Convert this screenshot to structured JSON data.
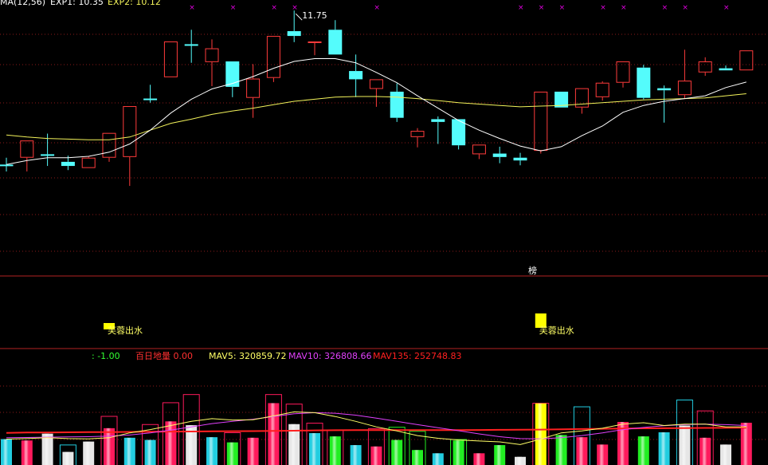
{
  "colors": {
    "up": "#ff3b3b",
    "down": "#54fcfc",
    "ma1": "#ffffff",
    "ma2": "#f2f25a",
    "panel_border": "#b22222",
    "grid": "#8b1a1a",
    "signal_box": "#ffff00",
    "signal_text": "#ffff66",
    "marker": "#e000e0",
    "mav5": "#ffff66",
    "mav10": "#e040fb",
    "mav135": "#ff2020",
    "value_green": "#33ff33",
    "white": "#ffffff",
    "vol_red": "#ff1a5c",
    "vol_cyan": "#22cde0",
    "vol_green": "#22ee22",
    "vol_white": "#e6e6e6",
    "vol_yellow": "#ffff00"
  },
  "price_panel": {
    "legend": [
      {
        "text": "MA(12,56)",
        "color": "#ffffff"
      },
      {
        "text": "EXP1: 10.35",
        "color": "#ffffff"
      },
      {
        "text": "EXP2: 10.12",
        "color": "#f2f25a"
      }
    ],
    "high_annotation": "11.75"
  },
  "signal_panel": {
    "bang_label": "榜",
    "signals": [
      {
        "candle": 5,
        "label": "芙蓉出水",
        "size": "small"
      },
      {
        "candle": 26,
        "label": "芙蓉出水",
        "size": "large"
      }
    ]
  },
  "volume_panel": {
    "indicators": [
      {
        "text": ": -1.00",
        "color": "#33ff33"
      },
      {
        "text": "百日地量  0.00",
        "color": "#ff3030"
      },
      {
        "text": "MAV5: 320859.72",
        "color": "#ffff66"
      },
      {
        "text": "MAV10: 326808.66",
        "color": "#e040fb"
      },
      {
        "text": "MAV135: 252748.83",
        "color": "#ff2020"
      }
    ]
  },
  "chart_data": {
    "type": "candlestick",
    "ylim": [
      8.25,
      12.1
    ],
    "candles": [
      {
        "o": 9.8,
        "h": 9.9,
        "l": 9.7,
        "c": 9.8,
        "dir": "down"
      },
      {
        "o": 9.9,
        "h": 10.15,
        "l": 9.7,
        "c": 10.15,
        "dir": "up"
      },
      {
        "o": 9.95,
        "h": 10.25,
        "l": 9.78,
        "c": 9.95,
        "dir": "down"
      },
      {
        "o": 9.78,
        "h": 9.93,
        "l": 9.72,
        "c": 9.84,
        "dir": "down"
      },
      {
        "o": 9.75,
        "h": 9.92,
        "l": 9.75,
        "c": 9.9,
        "dir": "up"
      },
      {
        "o": 9.9,
        "h": 10.26,
        "l": 9.84,
        "c": 10.26,
        "dir": "up"
      },
      {
        "o": 9.91,
        "h": 10.65,
        "l": 9.49,
        "c": 10.65,
        "dir": "up"
      },
      {
        "o": 10.76,
        "h": 10.96,
        "l": 10.7,
        "c": 10.76,
        "dir": "down"
      },
      {
        "o": 11.07,
        "h": 11.59,
        "l": 11.07,
        "c": 11.59,
        "dir": "up"
      },
      {
        "o": 11.55,
        "h": 11.76,
        "l": 11.28,
        "c": 11.55,
        "dir": "down"
      },
      {
        "o": 11.29,
        "h": 11.62,
        "l": 10.94,
        "c": 11.49,
        "dir": "up"
      },
      {
        "o": 11.3,
        "h": 11.3,
        "l": 10.78,
        "c": 10.93,
        "dir": "down"
      },
      {
        "o": 10.77,
        "h": 11.26,
        "l": 10.48,
        "c": 11.05,
        "dir": "up"
      },
      {
        "o": 11.06,
        "h": 11.67,
        "l": 11.0,
        "c": 11.67,
        "dir": "up"
      },
      {
        "o": 11.74,
        "h": 12.04,
        "l": 11.58,
        "c": 11.67,
        "dir": "down"
      },
      {
        "o": 11.59,
        "h": 11.59,
        "l": 11.39,
        "c": 11.59,
        "dir": "up"
      },
      {
        "o": 11.76,
        "h": 11.9,
        "l": 11.4,
        "c": 11.4,
        "dir": "down"
      },
      {
        "o": 11.16,
        "h": 11.4,
        "l": 10.78,
        "c": 11.04,
        "dir": "down"
      },
      {
        "o": 10.9,
        "h": 11.04,
        "l": 10.64,
        "c": 11.04,
        "dir": "up"
      },
      {
        "o": 10.86,
        "h": 10.98,
        "l": 10.42,
        "c": 10.48,
        "dir": "down"
      },
      {
        "o": 10.2,
        "h": 10.33,
        "l": 10.05,
        "c": 10.29,
        "dir": "up"
      },
      {
        "o": 10.46,
        "h": 10.5,
        "l": 10.1,
        "c": 10.42,
        "dir": "down"
      },
      {
        "o": 10.46,
        "h": 10.46,
        "l": 10.02,
        "c": 10.08,
        "dir": "down"
      },
      {
        "o": 9.95,
        "h": 10.09,
        "l": 9.88,
        "c": 10.09,
        "dir": "up"
      },
      {
        "o": 9.96,
        "h": 10.06,
        "l": 9.82,
        "c": 9.91,
        "dir": "down"
      },
      {
        "o": 9.9,
        "h": 9.97,
        "l": 9.79,
        "c": 9.86,
        "dir": "down"
      },
      {
        "o": 10.0,
        "h": 10.86,
        "l": 9.96,
        "c": 10.86,
        "dir": "up"
      },
      {
        "o": 10.86,
        "h": 10.86,
        "l": 10.63,
        "c": 10.63,
        "dir": "down"
      },
      {
        "o": 10.63,
        "h": 10.91,
        "l": 10.54,
        "c": 10.91,
        "dir": "up"
      },
      {
        "o": 10.78,
        "h": 11.01,
        "l": 10.73,
        "c": 10.99,
        "dir": "up"
      },
      {
        "o": 10.99,
        "h": 11.3,
        "l": 10.92,
        "c": 11.3,
        "dir": "up"
      },
      {
        "o": 11.21,
        "h": 11.25,
        "l": 10.75,
        "c": 10.77,
        "dir": "down"
      },
      {
        "o": 10.91,
        "h": 10.95,
        "l": 10.41,
        "c": 10.88,
        "dir": "down"
      },
      {
        "o": 10.81,
        "h": 11.47,
        "l": 10.76,
        "c": 11.02,
        "dir": "up"
      },
      {
        "o": 11.14,
        "h": 11.36,
        "l": 11.09,
        "c": 11.3,
        "dir": "up"
      },
      {
        "o": 11.2,
        "h": 11.24,
        "l": 11.17,
        "c": 11.17,
        "dir": "down"
      },
      {
        "o": 11.17,
        "h": 11.46,
        "l": 11.17,
        "c": 11.46,
        "dir": "up"
      }
    ],
    "ma_short": [
      9.8,
      9.86,
      9.9,
      9.9,
      9.92,
      9.98,
      10.1,
      10.3,
      10.55,
      10.75,
      10.9,
      10.98,
      11.08,
      11.2,
      11.3,
      11.34,
      11.34,
      11.28,
      11.14,
      10.99,
      10.8,
      10.62,
      10.44,
      10.3,
      10.18,
      10.07,
      10.0,
      10.06,
      10.22,
      10.36,
      10.56,
      10.66,
      10.72,
      10.76,
      10.8,
      10.92,
      11.0
    ],
    "ma_long": [
      10.23,
      10.2,
      10.18,
      10.17,
      10.16,
      10.16,
      10.2,
      10.3,
      10.4,
      10.46,
      10.53,
      10.58,
      10.62,
      10.67,
      10.72,
      10.75,
      10.78,
      10.79,
      10.79,
      10.78,
      10.76,
      10.73,
      10.7,
      10.68,
      10.66,
      10.64,
      10.65,
      10.66,
      10.68,
      10.7,
      10.72,
      10.74,
      10.75,
      10.76,
      10.77,
      10.8,
      10.83
    ],
    "volume": {
      "ylim": [
        0,
        360000
      ],
      "bars": [
        {
          "v": 95000,
          "style": "cyan"
        },
        {
          "v": 90000,
          "style": "red"
        },
        {
          "v": 115000,
          "style": "white"
        },
        {
          "v": 48000,
          "style": "white"
        },
        {
          "v": 86000,
          "style": "white"
        },
        {
          "v": 135000,
          "style": "red"
        },
        {
          "v": 100000,
          "style": "cyan"
        },
        {
          "v": 92000,
          "style": "cyan"
        },
        {
          "v": 160000,
          "style": "red"
        },
        {
          "v": 146000,
          "style": "white"
        },
        {
          "v": 102000,
          "style": "cyan"
        },
        {
          "v": 83000,
          "style": "green"
        },
        {
          "v": 100000,
          "style": "red"
        },
        {
          "v": 227000,
          "style": "red"
        },
        {
          "v": 150000,
          "style": "white"
        },
        {
          "v": 117000,
          "style": "cyan"
        },
        {
          "v": 105000,
          "style": "green"
        },
        {
          "v": 73000,
          "style": "cyan"
        },
        {
          "v": 68000,
          "style": "red"
        },
        {
          "v": 92000,
          "style": "green"
        },
        {
          "v": 55000,
          "style": "green"
        },
        {
          "v": 43000,
          "style": "cyan"
        },
        {
          "v": 90000,
          "style": "green"
        },
        {
          "v": 43000,
          "style": "red"
        },
        {
          "v": 73000,
          "style": "green"
        },
        {
          "v": 30000,
          "style": "white"
        },
        {
          "v": 226000,
          "style": "yellow"
        },
        {
          "v": 110000,
          "style": "green"
        },
        {
          "v": 102000,
          "style": "red"
        },
        {
          "v": 75000,
          "style": "red"
        },
        {
          "v": 158000,
          "style": "red"
        },
        {
          "v": 105000,
          "style": "green"
        },
        {
          "v": 120000,
          "style": "cyan"
        },
        {
          "v": 145000,
          "style": "white"
        },
        {
          "v": 100000,
          "style": "red"
        },
        {
          "v": 75000,
          "style": "white"
        },
        {
          "v": 155000,
          "style": "red"
        }
      ],
      "outline_bars": [
        {
          "v": 0,
          "style": "none"
        },
        {
          "v": 0,
          "style": "none"
        },
        {
          "v": 0,
          "style": "none"
        },
        {
          "v": 75000,
          "style": "cyan"
        },
        {
          "v": 0,
          "style": "none"
        },
        {
          "v": 180000,
          "style": "red"
        },
        {
          "v": 0,
          "style": "none"
        },
        {
          "v": 150000,
          "style": "red"
        },
        {
          "v": 230000,
          "style": "red"
        },
        {
          "v": 260000,
          "style": "red"
        },
        {
          "v": 0,
          "style": "none"
        },
        {
          "v": 120000,
          "style": "red"
        },
        {
          "v": 0,
          "style": "none"
        },
        {
          "v": 260000,
          "style": "red"
        },
        {
          "v": 225000,
          "style": "red"
        },
        {
          "v": 155000,
          "style": "red"
        },
        {
          "v": 130000,
          "style": "red"
        },
        {
          "v": 0,
          "style": "none"
        },
        {
          "v": 135000,
          "style": "red"
        },
        {
          "v": 140000,
          "style": "green"
        },
        {
          "v": 125000,
          "style": "green"
        },
        {
          "v": 0,
          "style": "none"
        },
        {
          "v": 95000,
          "style": "green"
        },
        {
          "v": 0,
          "style": "none"
        },
        {
          "v": 0,
          "style": "none"
        },
        {
          "v": 0,
          "style": "none"
        },
        {
          "v": 228000,
          "style": "red"
        },
        {
          "v": 0,
          "style": "none"
        },
        {
          "v": 215000,
          "style": "cyan"
        },
        {
          "v": 0,
          "style": "none"
        },
        {
          "v": 0,
          "style": "none"
        },
        {
          "v": 0,
          "style": "none"
        },
        {
          "v": 0,
          "style": "none"
        },
        {
          "v": 240000,
          "style": "cyan"
        },
        {
          "v": 200000,
          "style": "red"
        },
        {
          "v": 0,
          "style": "none"
        },
        {
          "v": 0,
          "style": "none"
        }
      ],
      "mav5": [
        95000,
        97000,
        100000,
        97000,
        96000,
        100000,
        118000,
        130000,
        145000,
        160000,
        170000,
        165000,
        166000,
        180000,
        195000,
        192000,
        178000,
        160000,
        140000,
        125000,
        108000,
        98000,
        92000,
        88000,
        85000,
        75000,
        95000,
        118000,
        125000,
        135000,
        150000,
        155000,
        145000,
        150000,
        150000,
        140000,
        140000
      ],
      "mav10": [
        100000,
        101000,
        102000,
        103000,
        104000,
        106000,
        110000,
        118000,
        128000,
        140000,
        152000,
        160000,
        168000,
        178000,
        188000,
        192000,
        190000,
        183000,
        172000,
        160000,
        148000,
        137000,
        126000,
        114000,
        104000,
        97000,
        96000,
        100000,
        108000,
        118000,
        130000,
        138000,
        144000,
        148000,
        150000,
        148000,
        145000
      ],
      "mav135": [
        118000,
        119000,
        119500,
        120000,
        120500,
        121000,
        121500,
        122000,
        122500,
        123000,
        123500,
        124000,
        124500,
        125000,
        126000,
        127000,
        127500,
        128000,
        128000,
        128000,
        128000,
        128000,
        128000,
        128500,
        129000,
        129500,
        130000,
        131000,
        132000,
        133000,
        134000,
        134500,
        135000,
        135500,
        136000,
        136500,
        137000
      ]
    }
  }
}
